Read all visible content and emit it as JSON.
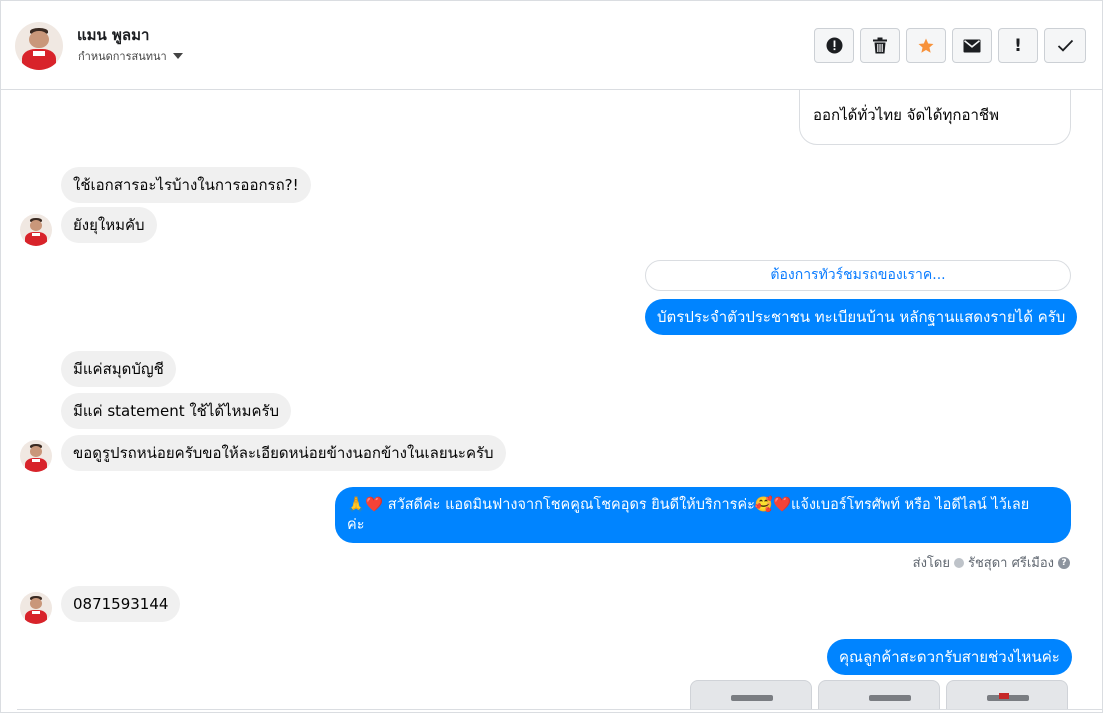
{
  "header": {
    "name": "แมน พูลมา",
    "assign_label": "กำหนดการสนทนา",
    "tools": [
      {
        "icon": "alert-circle-icon",
        "glyph": "!"
      },
      {
        "icon": "trash-icon",
        "glyph": "🗑"
      },
      {
        "icon": "star-icon",
        "glyph": "★"
      },
      {
        "icon": "envelope-icon",
        "glyph": "✉"
      },
      {
        "icon": "exclamation-icon",
        "glyph": "!"
      },
      {
        "icon": "checkmark-icon",
        "glyph": "✓"
      }
    ],
    "star_color": "#f7923b"
  },
  "messages": {
    "m0": "ออกได้ทั่วไทย จัดได้ทุกอาชีพ",
    "m1": "ใช้เอกสารอะไรบ้างในการออกรถ?!",
    "m2": "ยังยุใหมคับ",
    "m3": "ต้องการทัวร์ชมรถของเราค...",
    "m4": "บัตรประจำตัวประชาชน ทะเบียนบ้าน หลักฐานแสดงรายได้ ครับ",
    "m5": "มีแค่สมุดบัญชี",
    "m6": "มีแค่ statement ใช้ได้ไหมครับ",
    "m7": "ขอดูรูปรถหน่อยครับขอให้ละเอียดหน่อยข้างนอกข้างในเลยนะครับ",
    "m8_line1": "🙏❤️ สวัสดีค่ะ แอดมินฟางจากโชคคูณโชคอุดร ยินดีให้บริการค่ะ🥰❤️แจ้งเบอร์โทรศัพท์ หรือ ไอดีไลน์  ไว้เลย",
    "m8_line2": "ค่ะ",
    "sent_by_label": "ส่งโดย",
    "sent_by_name": "รัชสุดา ศรีเมือง",
    "m9": "0871593144",
    "m10": "คุณลูกค้าสะดวกรับสายช่วงไหนค่ะ"
  },
  "colors": {
    "outgoing": "#0084ff",
    "incoming": "#f0f0f0",
    "link_text": "#0a7cff"
  }
}
